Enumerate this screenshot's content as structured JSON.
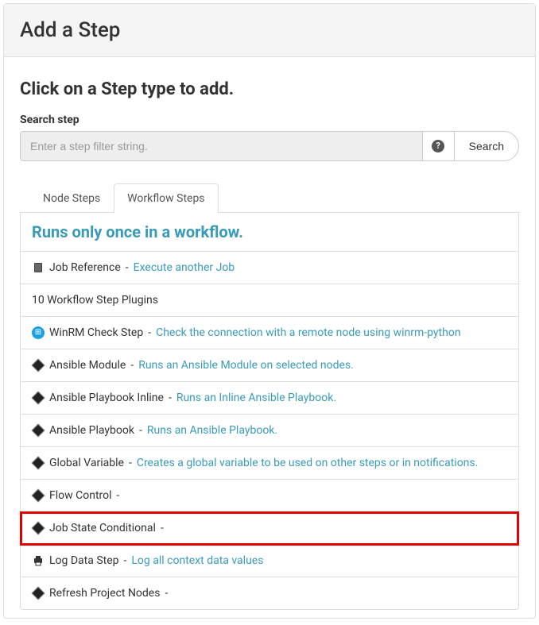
{
  "header": {
    "title": "Add a Step"
  },
  "subtitle": "Click on a Step type to add.",
  "search": {
    "label": "Search step",
    "placeholder": "Enter a step filter string.",
    "button": "Search"
  },
  "tabs": {
    "node": "Node Steps",
    "workflow": "Workflow Steps"
  },
  "list": {
    "header": "Runs only once in a workflow.",
    "job_ref": {
      "name": "Job Reference",
      "desc": "Execute another Job"
    },
    "count_label": "10 Workflow Step Plugins",
    "items": [
      {
        "name": "WinRM Check Step",
        "desc": "Check the connection with a remote node using winrm-python"
      },
      {
        "name": "Ansible Module",
        "desc": "Runs an Ansible Module on selected nodes."
      },
      {
        "name": "Ansible Playbook Inline",
        "desc": "Runs an Inline Ansible Playbook."
      },
      {
        "name": "Ansible Playbook",
        "desc": "Runs an Ansible Playbook."
      },
      {
        "name": "Global Variable",
        "desc": "Creates a global variable to be used on other steps or in notifications."
      },
      {
        "name": "Flow Control",
        "desc": ""
      },
      {
        "name": "Job State Conditional",
        "desc": ""
      },
      {
        "name": "Log Data Step",
        "desc": "Log all context data values"
      },
      {
        "name": "Refresh Project Nodes",
        "desc": ""
      }
    ]
  }
}
